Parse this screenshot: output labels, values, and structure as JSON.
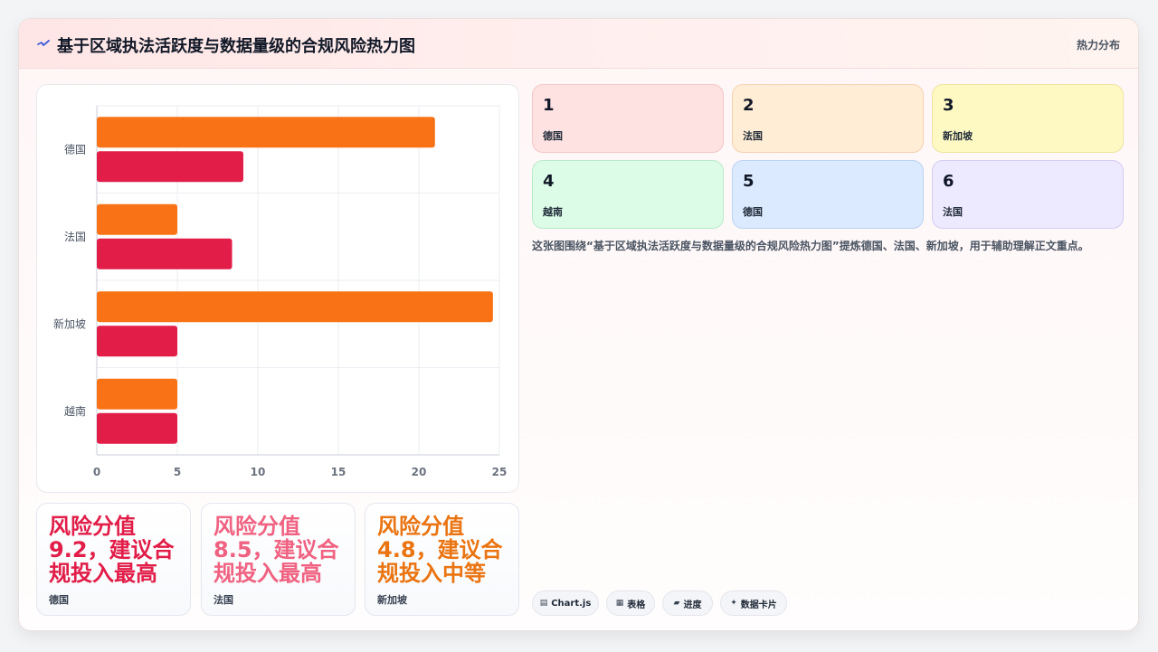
{
  "header": {
    "title": "基于区域执法活跃度与数据量级的合规风险热力图",
    "tag": "热力分布",
    "icon": "spark-icon"
  },
  "chart_data": {
    "type": "bar",
    "orientation": "horizontal",
    "categories": [
      "德国",
      "法国",
      "新加坡",
      "越南"
    ],
    "series": [
      {
        "values": [
          21,
          5,
          24.6,
          5
        ],
        "color": "#f97316"
      },
      {
        "values": [
          9.1,
          8.4,
          5,
          5
        ],
        "color": "#e11d48"
      }
    ],
    "xlim": [
      0,
      25
    ],
    "xticks": [
      0,
      5,
      10,
      15,
      20,
      25
    ],
    "grid": true,
    "legend": "none"
  },
  "stats": [
    {
      "value": "风险分值9.2，建议合规投入最高",
      "label": "德国",
      "color": "#e11d48"
    },
    {
      "value": "风险分值8.5，建议合规投入最高",
      "label": "法国",
      "color": "#f06281"
    },
    {
      "value": "风险分值4.8，建议合规投入中等",
      "label": "新加坡",
      "color": "#ea7411"
    }
  ],
  "tiles": [
    {
      "num": "1",
      "label": "德国",
      "bg": "#fee2e2",
      "border": "#f5c5c5"
    },
    {
      "num": "2",
      "label": "法国",
      "bg": "#ffedd5",
      "border": "#f7d2b0"
    },
    {
      "num": "3",
      "label": "新加坡",
      "bg": "#fef9c3",
      "border": "#efe3a0"
    },
    {
      "num": "4",
      "label": "越南",
      "bg": "#dcfce7",
      "border": "#b9eac8"
    },
    {
      "num": "5",
      "label": "德国",
      "bg": "#dbeafe",
      "border": "#bcd3f3"
    },
    {
      "num": "6",
      "label": "法国",
      "bg": "#ede9fe",
      "border": "#d4ccf4"
    }
  ],
  "description": "这张图围绕“基于区域执法活跃度与数据量级的合规风险热力图”提炼德国、法国、新加坡，用于辅助理解正文重点。",
  "chips": [
    {
      "icon": "▤",
      "label": "Chart.js"
    },
    {
      "icon": "▦",
      "label": "表格"
    },
    {
      "icon": "▰",
      "label": "进度"
    },
    {
      "icon": "✦",
      "label": "数据卡片"
    }
  ]
}
